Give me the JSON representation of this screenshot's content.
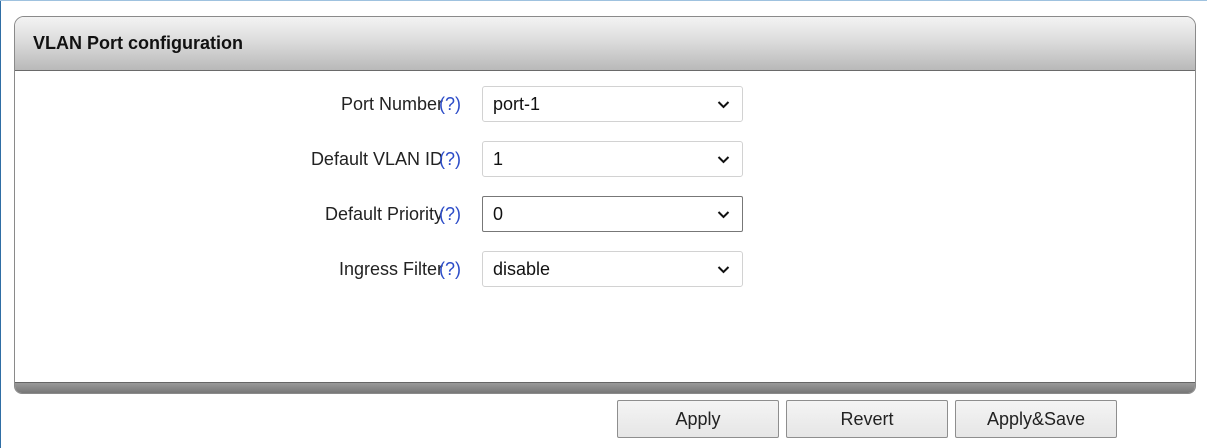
{
  "panel": {
    "title": "VLAN Port configuration"
  },
  "fields": [
    {
      "label": "Port Number",
      "help": "(?)",
      "value": "port-1"
    },
    {
      "label": "Default VLAN ID",
      "help": "(?)",
      "value": "1"
    },
    {
      "label": "Default Priority",
      "help": "(?)",
      "value": "0"
    },
    {
      "label": "Ingress Filter",
      "help": "(?)",
      "value": "disable"
    }
  ],
  "buttons": {
    "apply": "Apply",
    "revert": "Revert",
    "apply_save": "Apply&Save"
  },
  "colors": {
    "help_link": "#2c4cc8",
    "header_gradient_top": "#f3f3f3",
    "header_gradient_bottom": "#b9b9b9",
    "frame_accent": "#2f6ea5"
  },
  "icons": {
    "select_arrow": "chevron-down-icon"
  }
}
